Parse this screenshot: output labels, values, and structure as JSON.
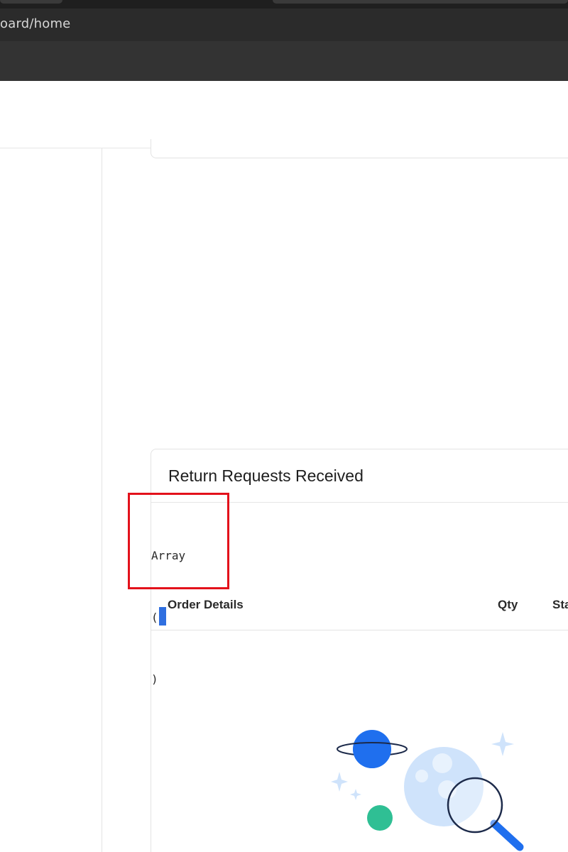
{
  "browser": {
    "url": "oard/home"
  },
  "card": {
    "title": "Return Requests Received"
  },
  "debug_output": {
    "lines": [
      "Array",
      "(",
      ")"
    ]
  },
  "table": {
    "headers": [
      "Order Details",
      "Qty",
      "Sta"
    ]
  },
  "empty_state": {
    "icon": "search-empty-illustration"
  },
  "colors": {
    "highlight": "#e3111b",
    "caret": "#2f6fe0",
    "planet": "#1f6fee",
    "moon": "#cfe3fb",
    "green_dot": "#2fbf94"
  }
}
